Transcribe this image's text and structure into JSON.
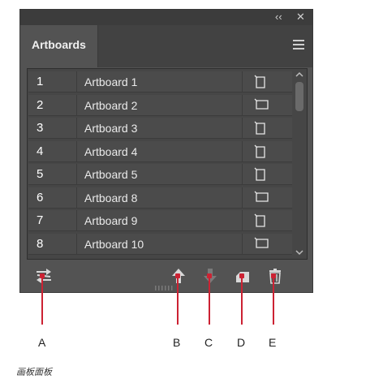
{
  "panel": {
    "tab_label": "Artboards",
    "collapse_glyph": "‹‹",
    "close_glyph": "✕"
  },
  "artboards": [
    {
      "num": "1",
      "name": "Artboard 1",
      "orientation": "portrait"
    },
    {
      "num": "2",
      "name": "Artboard 2",
      "orientation": "landscape"
    },
    {
      "num": "3",
      "name": "Artboard 3",
      "orientation": "portrait"
    },
    {
      "num": "4",
      "name": "Artboard 4",
      "orientation": "portrait"
    },
    {
      "num": "5",
      "name": "Artboard 5",
      "orientation": "portrait"
    },
    {
      "num": "6",
      "name": "Artboard 8",
      "orientation": "landscape"
    },
    {
      "num": "7",
      "name": "Artboard 9",
      "orientation": "portrait"
    },
    {
      "num": "8",
      "name": "Artboard 10",
      "orientation": "landscape"
    }
  ],
  "toolbar": [
    {
      "id": "rearrange",
      "icon": "rearrange-icon"
    },
    {
      "id": "move-up",
      "icon": "arrow-up-icon"
    },
    {
      "id": "move-down",
      "icon": "arrow-down-icon"
    },
    {
      "id": "new-artboard",
      "icon": "new-artboard-icon"
    },
    {
      "id": "delete",
      "icon": "trash-icon"
    }
  ],
  "callouts": [
    "A",
    "B",
    "C",
    "D",
    "E"
  ],
  "caption": "画板面板",
  "colors": {
    "callout": "#cc2233",
    "panel": "#535353",
    "list": "#464646"
  }
}
